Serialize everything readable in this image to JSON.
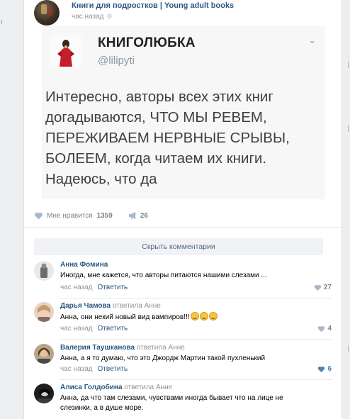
{
  "sidebar_left": {
    "glyph": "ı"
  },
  "post": {
    "group_name": "Книги для подростков | Young adult books",
    "time": "час назад",
    "icons": {
      "settings": "gear-icon"
    }
  },
  "quote": {
    "name": "КНИГОЛЮБКА",
    "handle": "@lilipyti",
    "text": "Интересно, авторы всех этих книг догадываются, ЧТО МЫ РЕВЕМ, ПЕРЕЖИВАЕМ НЕРВНЫЕ СРЫВЫ, БОЛЕЕМ, когда читаем их книги. Надеюсь, что да"
  },
  "actions": {
    "like_label": "Мне нравится",
    "like_count": "1359",
    "share_count": "26"
  },
  "comments_toggle": "Скрыть комментарии",
  "comments": [
    {
      "author": "Анна Фомина",
      "reply_to": "",
      "text": "Иногда, мне кажется, что авторы питаются нашими слезами ...",
      "time": "час назад",
      "reply_label": "Ответить",
      "likes": "27",
      "liked": false
    },
    {
      "author": "Дарья Чамова",
      "reply_to": "ответила Анне",
      "text": "Анна, они некий новый вид вампиров!!!",
      "time": "час назад",
      "reply_label": "Ответить",
      "likes": "4",
      "liked": false
    },
    {
      "author": "Валерия Таушканова",
      "reply_to": "ответила Анне",
      "text": "Анна, а я то думаю, что это Джордж Мартин такой пухленький",
      "time": "час назад",
      "reply_label": "Ответить",
      "likes": "6",
      "liked": true
    },
    {
      "author": "Алиса Голдобина",
      "reply_to": "ответила Анне",
      "text": "Анна, да что там слезами, чувствами иногда бывает что на лице не слезинки, а в душе море.",
      "time": "",
      "reply_label": "",
      "likes": "",
      "liked": false
    }
  ],
  "colors": {
    "link": "#2a5885",
    "muted": "#939393",
    "accent_like": "#5181b8",
    "background": "#edeef0"
  }
}
